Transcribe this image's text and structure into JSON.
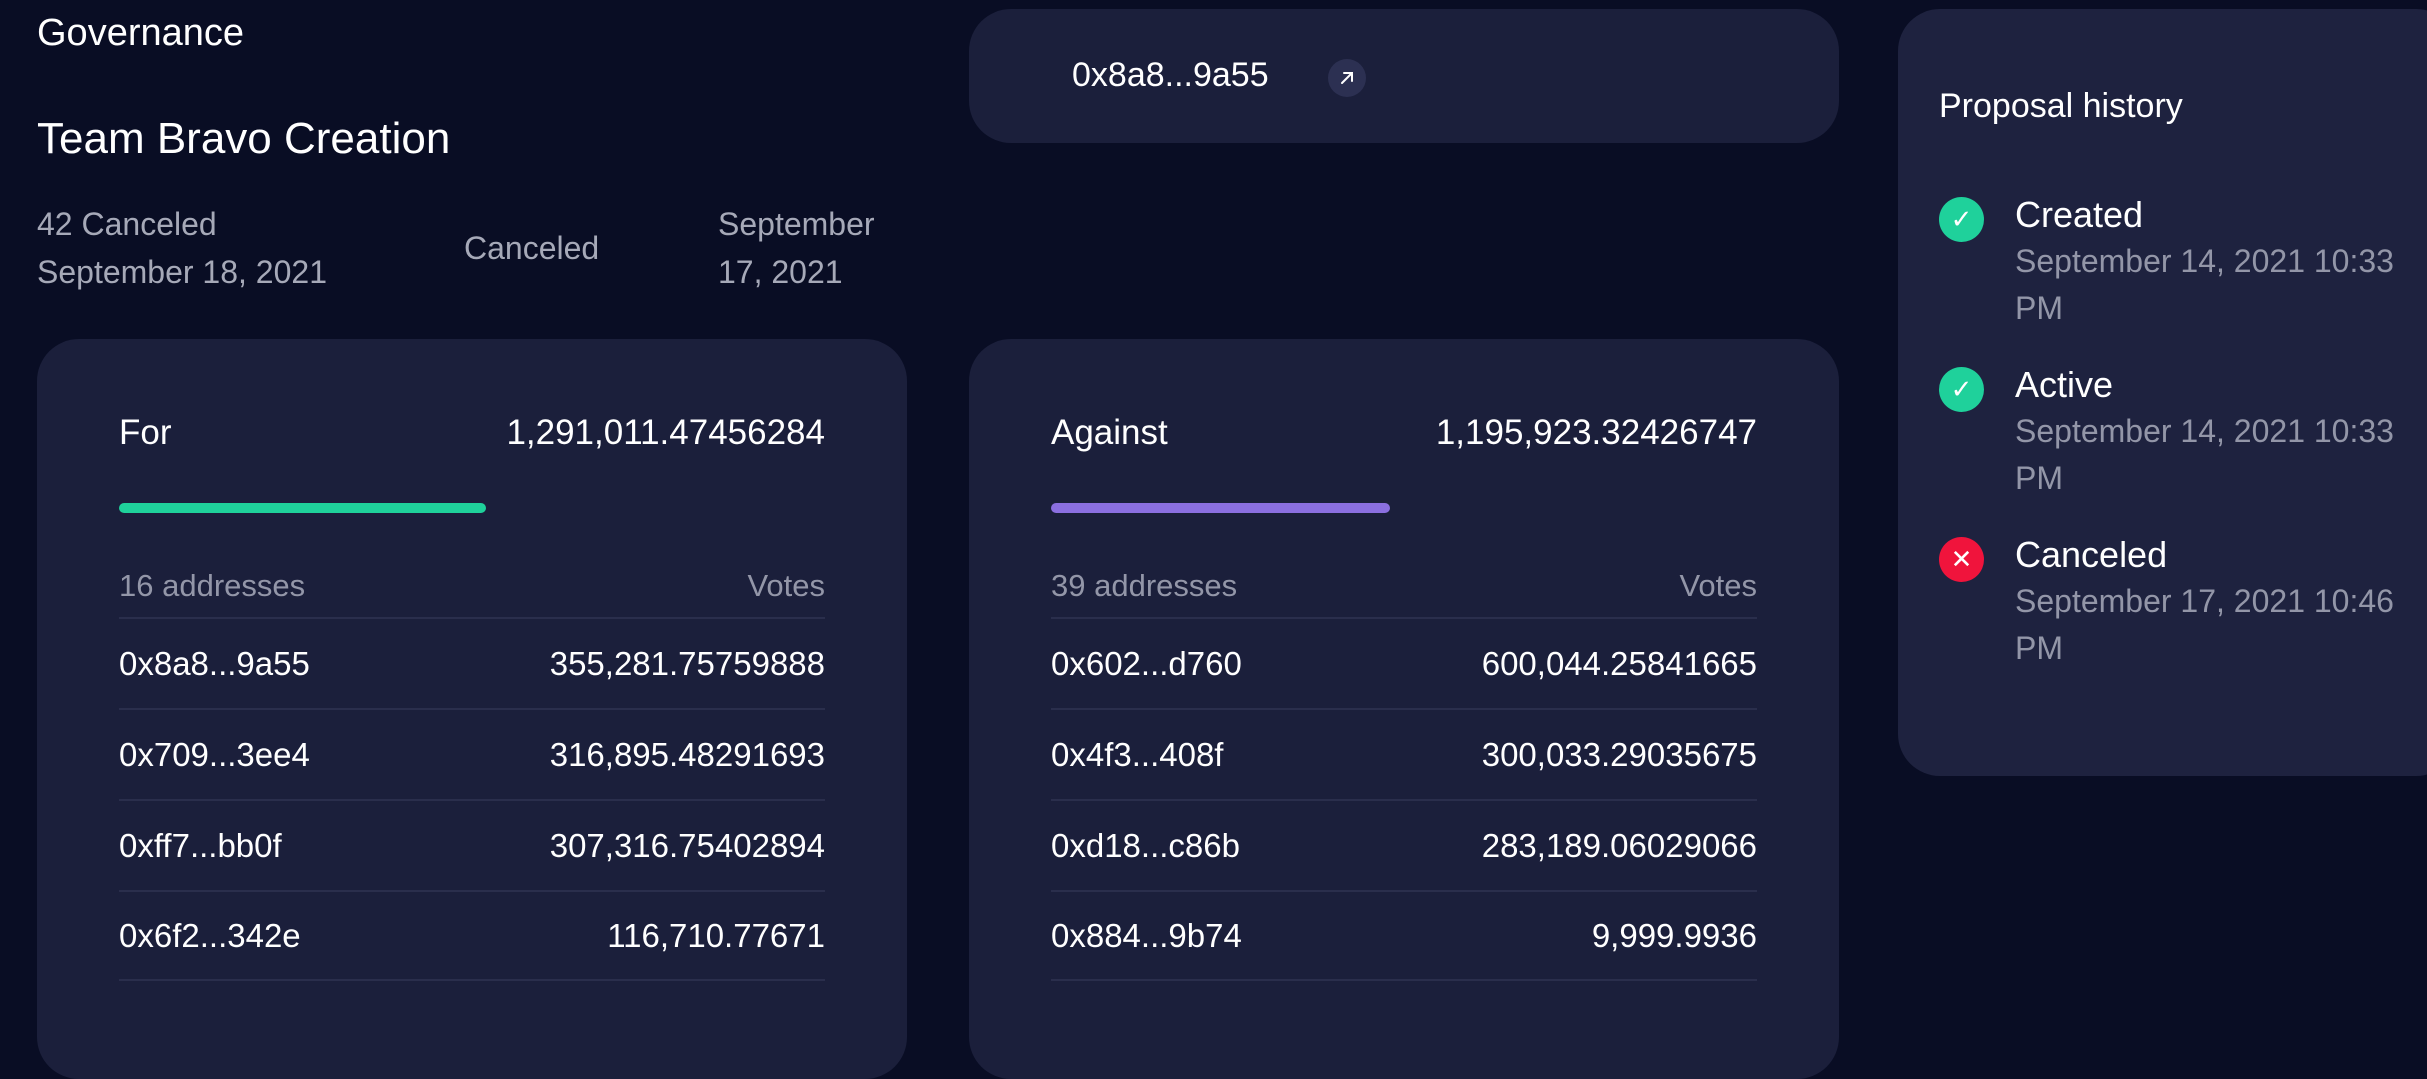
{
  "breadcrumb": "Governance",
  "proposal": {
    "title": "Team Bravo Creation",
    "meta_left": "42 Canceled September 18, 2021",
    "meta_status": "Canceled",
    "meta_date": "September 17, 2021"
  },
  "proposer": {
    "address": "0x8a8...9a55",
    "link_icon": "external-link-icon"
  },
  "colors": {
    "for_bar": "#1fd19b",
    "against_bar": "#8b6fe0",
    "canceled": "#f0143c",
    "success": "#1fd19b"
  },
  "for_votes": {
    "label": "For",
    "total": "1,291,011.47456284",
    "bar_fraction": 0.52,
    "addresses_label": "16 addresses",
    "votes_label": "Votes",
    "rows": [
      {
        "address": "0x8a8...9a55",
        "votes": "355,281.75759888"
      },
      {
        "address": "0x709...3ee4",
        "votes": "316,895.48291693"
      },
      {
        "address": "0xff7...bb0f",
        "votes": "307,316.75402894"
      },
      {
        "address": "0x6f2...342e",
        "votes": "116,710.77671"
      }
    ]
  },
  "against_votes": {
    "label": "Against",
    "total": "1,195,923.32426747",
    "bar_fraction": 0.48,
    "addresses_label": "39 addresses",
    "votes_label": "Votes",
    "rows": [
      {
        "address": "0x602...d760",
        "votes": "600,044.25841665"
      },
      {
        "address": "0x4f3...408f",
        "votes": "300,033.29035675"
      },
      {
        "address": "0xd18...c86b",
        "votes": "283,189.06029066"
      },
      {
        "address": "0x884...9b74",
        "votes": "9,999.9936"
      }
    ]
  },
  "history": {
    "title": "Proposal history",
    "steps": [
      {
        "label": "Created",
        "date": "September 14, 2021 10:33 PM",
        "icon": "check-icon"
      },
      {
        "label": "Active",
        "date": "September 14, 2021 10:33 PM",
        "icon": "check-icon"
      },
      {
        "label": "Canceled",
        "date": "September 17, 2021 10:46 PM",
        "icon": "close-icon"
      }
    ]
  }
}
